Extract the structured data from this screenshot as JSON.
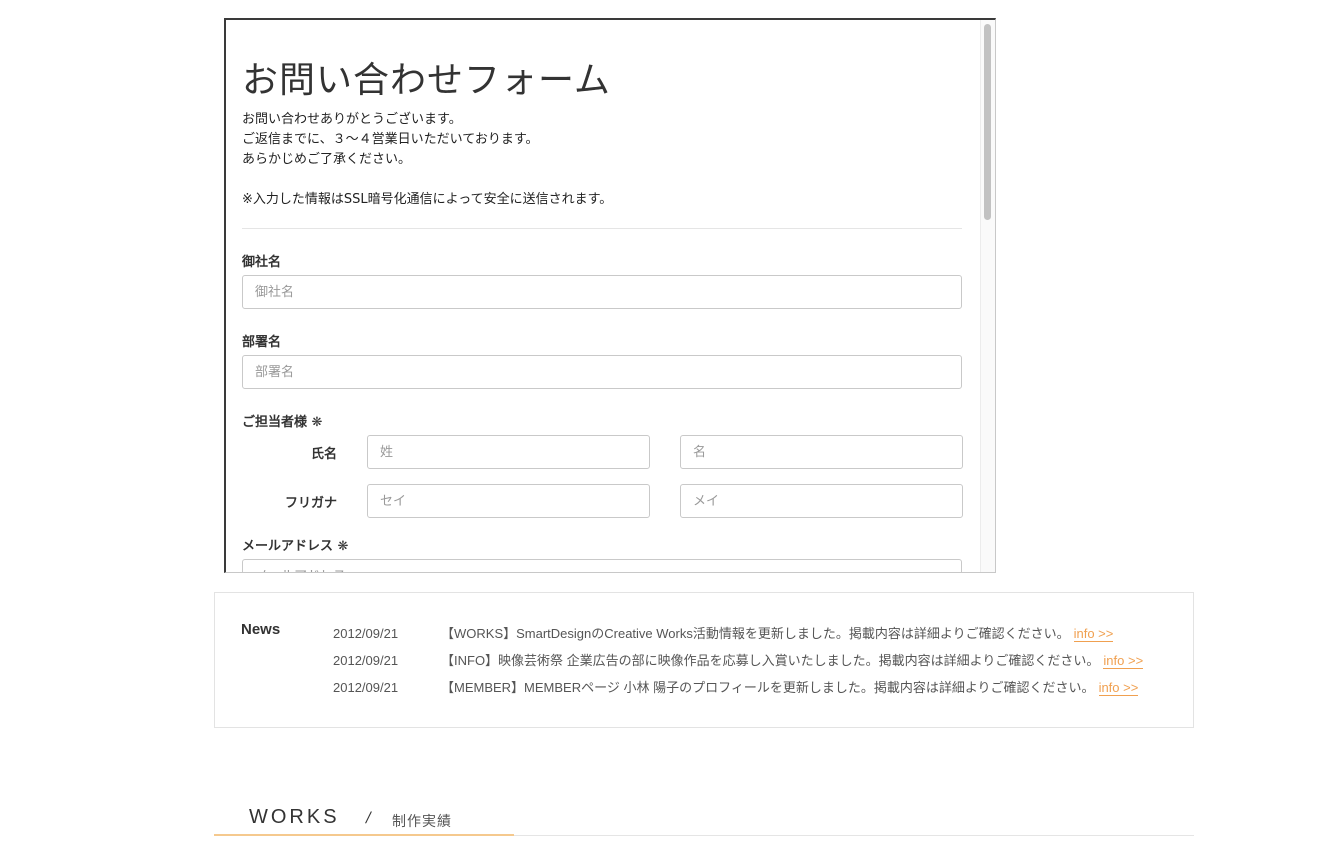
{
  "form": {
    "title": "お問い合わせフォーム",
    "intro_lines": [
      "お問い合わせありがとうございます。",
      "ご返信までに、３〜４営業日いただいております。",
      "あらかじめご了承ください。"
    ],
    "ssl_note": "※入力した情報はSSL暗号化通信によって安全に送信されます。",
    "company": {
      "label": "御社名",
      "placeholder": "御社名",
      "value": ""
    },
    "department": {
      "label": "部署名",
      "placeholder": "部署名",
      "value": ""
    },
    "contact": {
      "label": "ご担当者様 ❋",
      "name_label": "氏名",
      "last_name_placeholder": "姓",
      "first_name_placeholder": "名",
      "kana_label": "フリガナ",
      "last_kana_placeholder": "セイ",
      "first_kana_placeholder": "メイ"
    },
    "email": {
      "label": "メールアドレス ❋",
      "placeholder": "メールアドレス",
      "value": ""
    }
  },
  "news": {
    "title": "News",
    "items": [
      {
        "date": "2012/09/21",
        "text": "【WORKS】SmartDesignのCreative Works活動情報を更新しました。掲載内容は詳細よりご確認ください。",
        "link": "info >>"
      },
      {
        "date": "2012/09/21",
        "text": "【INFO】映像芸術祭 企業広告の部に映像作品を応募し入賞いたしました。掲載内容は詳細よりご確認ください。",
        "link": "info >>"
      },
      {
        "date": "2012/09/21",
        "text": "【MEMBER】MEMBERページ 小林 陽子のプロフィールを更新しました。掲載内容は詳細よりご確認ください。",
        "link": "info >>"
      }
    ]
  },
  "works": {
    "title": "WORKS",
    "separator": "/",
    "subtitle": "制作実績"
  },
  "colors": {
    "accent": "#f0a050",
    "border": "#e3e3e3"
  }
}
